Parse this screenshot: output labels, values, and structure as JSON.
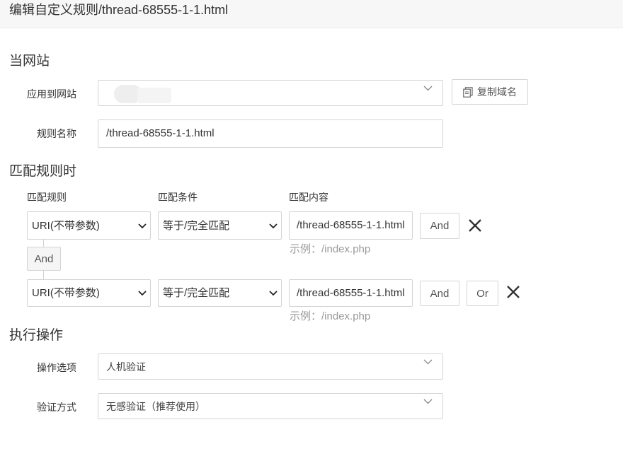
{
  "header": {
    "title": "编辑自定义规则/thread-68555-1-1.html"
  },
  "site_section": {
    "title": "当网站",
    "apply_label": "应用到网站",
    "apply_value": "",
    "copy_domain_label": "复制域名",
    "rule_name_label": "规则名称",
    "rule_name_value": "/thread-68555-1-1.html"
  },
  "match_section": {
    "title": "匹配规则时",
    "col_rule": "匹配规则",
    "col_condition": "匹配条件",
    "col_content": "匹配内容",
    "joiner": "And",
    "rows": [
      {
        "rule": "URI(不带参数)",
        "condition": "等于/完全匹配",
        "content": "/thread-68555-1-1.html",
        "hint": "示例：/index.php",
        "and_label": "And"
      },
      {
        "rule": "URI(不带参数)",
        "condition": "等于/完全匹配",
        "content": "/thread-68555-1-1.html",
        "hint": "示例：/index.php",
        "and_label": "And",
        "or_label": "Or"
      }
    ]
  },
  "action_section": {
    "title": "执行操作",
    "option_label": "操作选项",
    "option_value": "人机验证",
    "verify_label": "验证方式",
    "verify_value": "无感验证（推荐使用）"
  },
  "colors": {
    "border": "#d4d4d4",
    "hint": "#999999",
    "header_bg": "#f7f7f7"
  }
}
